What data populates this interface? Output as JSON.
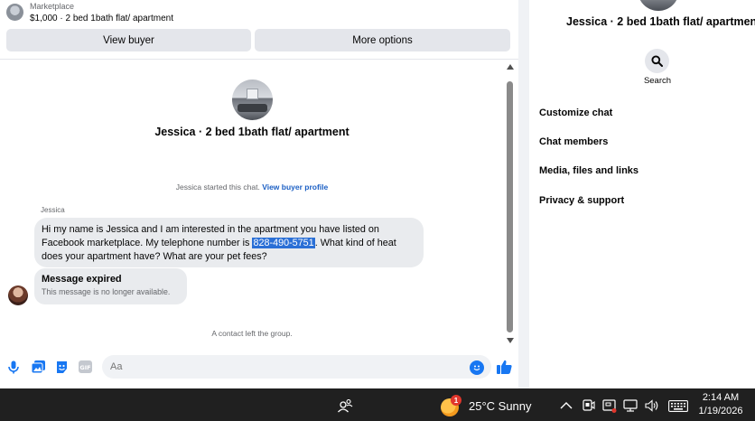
{
  "marketplace": {
    "label": "Marketplace",
    "listing": "$1,000 · 2 bed 1bath flat/ apartment",
    "view_buyer_label": "View buyer",
    "more_options_label": "More options"
  },
  "chat": {
    "title": "Jessica · 2 bed 1bath flat/ apartment",
    "started_text": "Jessica started this chat.",
    "view_buyer_profile": "View buyer profile",
    "sender_name": "Jessica",
    "message_before": "Hi my name is Jessica and I am interested in the apartment you have listed on Facebook marketplace. My telephone number is ",
    "message_highlight": "828-490-5751",
    "message_after": ". What kind of heat does your apartment have? What are your pet fees?",
    "expired_title": "Message expired",
    "expired_sub": "This message is no longer available.",
    "contact_left": "A contact left the group.",
    "composer_placeholder": "Aa"
  },
  "info_pane": {
    "title": "Jessica · 2 bed 1bath flat/ apartment",
    "search_label": "Search",
    "items": [
      "Customize chat",
      "Chat members",
      "Media, files and links",
      "Privacy & support"
    ]
  },
  "taskbar": {
    "weather_badge": "1",
    "weather_text": "25°C  Sunny",
    "time": "2:14 AM",
    "date": "1/19/2026"
  },
  "icons": {
    "composer": [
      "microphone-icon",
      "photo-icon",
      "sticker-icon",
      "gif-icon",
      "emoji-icon",
      "thumbs-up-icon"
    ],
    "tray": [
      "chevron-up-icon",
      "meet-now-icon",
      "screen-capture-icon",
      "network-icon",
      "volume-icon",
      "keyboard-icon"
    ]
  },
  "colors": {
    "accent": "#1877f2",
    "highlight": "#2a6fd6",
    "bubble": "#e9ebee",
    "taskbar": "#202020"
  }
}
